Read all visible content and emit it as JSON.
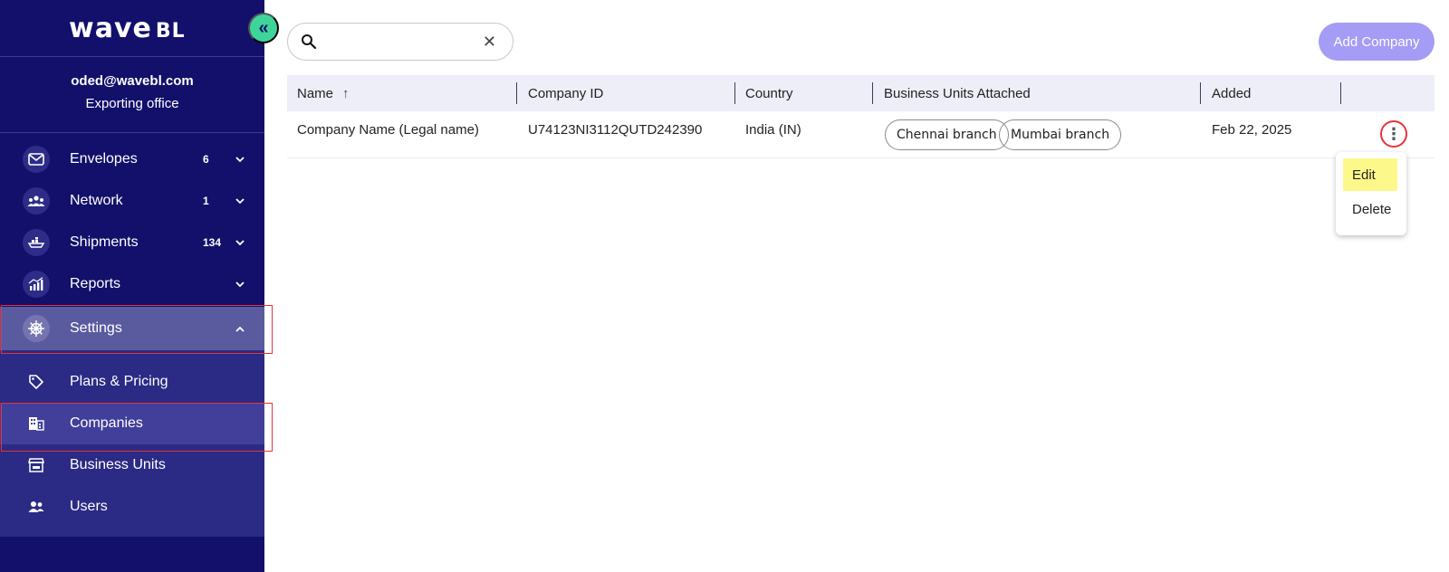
{
  "brand": {
    "logo_main": "wave",
    "logo_suffix": "BL",
    "collapse_glyph": "«"
  },
  "user": {
    "email": "oded@wavebl.com",
    "role": "Exporting office"
  },
  "nav": {
    "items": [
      {
        "label": "Envelopes",
        "badge": "6",
        "icon": "envelope-icon"
      },
      {
        "label": "Network",
        "badge": "1",
        "icon": "network-icon"
      },
      {
        "label": "Shipments",
        "badge": "134",
        "icon": "ship-icon"
      },
      {
        "label": "Reports",
        "badge": "",
        "icon": "chart-icon"
      },
      {
        "label": "Settings",
        "badge": "",
        "icon": "helm-icon"
      }
    ],
    "chevron_down": "⌄",
    "chevron_up": "^",
    "sub_items": [
      {
        "label": "Plans & Pricing",
        "icon": "tag-icon"
      },
      {
        "label": "Companies",
        "icon": "building-icon"
      },
      {
        "label": "Business Units",
        "icon": "store-icon"
      },
      {
        "label": "Users",
        "icon": "users-icon"
      }
    ]
  },
  "search": {
    "value": "",
    "placeholder": "",
    "clear_glyph": "✕"
  },
  "toolbar": {
    "add_label": "Add Company"
  },
  "table": {
    "columns": [
      "Name",
      "Company ID",
      "Country",
      "Business Units Attached",
      "Added"
    ],
    "sort_glyph": "↑",
    "rows": [
      {
        "name": "Company Name (Legal name)",
        "company_id": "U74123NI3112QUTD242390",
        "country": "India (IN)",
        "units": [
          "Chennai branch",
          "Mumbai branch"
        ],
        "added": "Feb 22, 2025"
      }
    ]
  },
  "row_menu": {
    "kebab_glyph": "⋮",
    "edit_label": "Edit",
    "delete_label": "Delete"
  },
  "colors": {
    "sidebar_bg": "#12106a",
    "accent_green": "#3ed59a",
    "add_button": "#a59cf5",
    "highlight_red": "#e8333a",
    "menu_hover": "#fdf88a"
  }
}
